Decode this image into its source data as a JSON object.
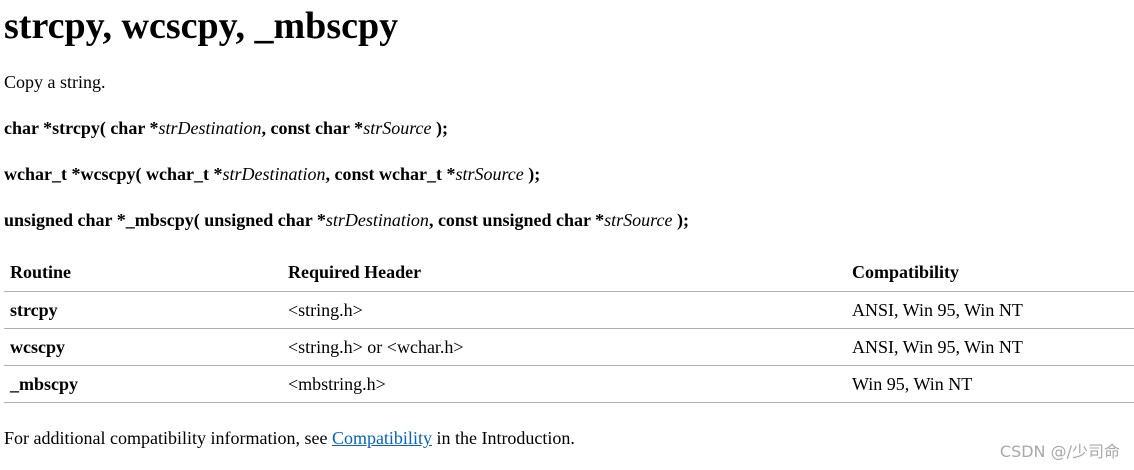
{
  "title": "strcpy, wcscpy, _mbscpy",
  "intro": "Copy a string.",
  "signatures": [
    {
      "ret": "char *strcpy( char *",
      "p1": "strDestination",
      "mid": ", const char *",
      "p2": "strSource",
      "end": " );"
    },
    {
      "ret": "wchar_t *wcscpy( wchar_t *",
      "p1": "strDestination",
      "mid": ", const wchar_t *",
      "p2": "strSource",
      "end": " );"
    },
    {
      "ret": "unsigned char *_mbscpy( unsigned char *",
      "p1": "strDestination",
      "mid": ", const unsigned char *",
      "p2": "strSource",
      "end": " );"
    }
  ],
  "table": {
    "headers": [
      "Routine",
      "Required Header",
      "Compatibility"
    ],
    "rows": [
      [
        "strcpy",
        "<string.h>",
        "ANSI, Win 95, Win NT"
      ],
      [
        "wcscpy",
        "<string.h> or <wchar.h>",
        "ANSI, Win 95, Win NT"
      ],
      [
        "_mbscpy",
        "<mbstring.h>",
        "Win 95, Win NT"
      ]
    ]
  },
  "footer": {
    "before": "For additional compatibility information, see ",
    "link": "Compatibility",
    "after": " in the Introduction."
  },
  "watermark": "CSDN @/少司命",
  "colors": {
    "link": "#0563c1",
    "watermark": "#a8a8a8",
    "rule": "#b0b0b0"
  }
}
